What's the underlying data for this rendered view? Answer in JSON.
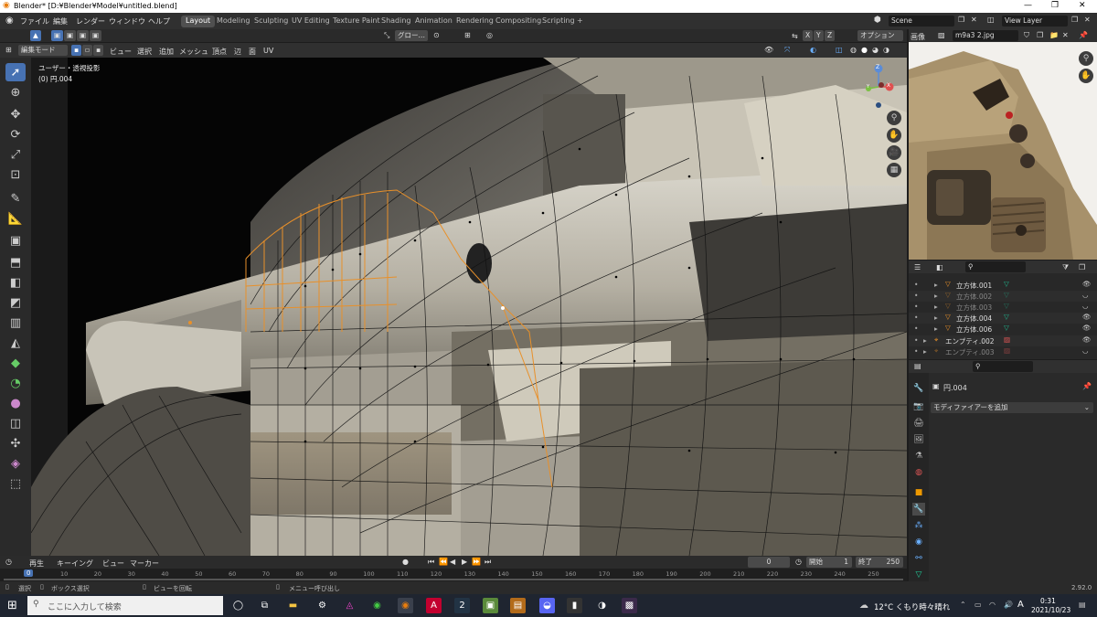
{
  "window": {
    "title": "Blender* [D:¥Blender¥Model¥untitled.blend]",
    "minimize": "—",
    "maximize": "❐",
    "close": "✕"
  },
  "menus": [
    "ファイル",
    "編集",
    "レンダー",
    "ウィンドウ",
    "ヘルプ"
  ],
  "workspaces": [
    "Layout",
    "Modeling",
    "Sculpting",
    "UV Editing",
    "Texture Paint",
    "Shading",
    "Animation",
    "Rendering",
    "Compositing",
    "Scripting"
  ],
  "active_workspace": "Layout",
  "scene": {
    "name": "Scene",
    "view_layer": "View Layer"
  },
  "header2": {
    "transform": "グロー…",
    "options": "オプション"
  },
  "axes": [
    "X",
    "Y",
    "Z"
  ],
  "viewport_header": {
    "mode": "編集モード",
    "menus": [
      "ビュー",
      "選択",
      "追加",
      "メッシュ",
      "頂点",
      "辺",
      "面",
      "UV"
    ]
  },
  "viewport_overlay": {
    "line1": "ユーザー・透視投影",
    "line2": "(0) 円.004"
  },
  "gizmo": {
    "x": "X",
    "y": "Y",
    "z": "Z"
  },
  "image_editor": {
    "label": "画像",
    "image_name": "m9a3 2.jpg"
  },
  "outliner": {
    "rows": [
      {
        "name": "立方体.001",
        "type": "mesh",
        "dim": false
      },
      {
        "name": "立方体.002",
        "type": "mesh",
        "dim": true
      },
      {
        "name": "立方体.003",
        "type": "mesh",
        "dim": true
      },
      {
        "name": "立方体.004",
        "type": "mesh",
        "dim": false
      },
      {
        "name": "立方体.006",
        "type": "mesh",
        "dim": false
      },
      {
        "name": "エンプティ.002",
        "type": "empty",
        "dim": false
      },
      {
        "name": "エンプティ.003",
        "type": "empty",
        "dim": true
      }
    ]
  },
  "properties": {
    "object": "円.004",
    "add_modifier": "モディファイアーを追加"
  },
  "timeline": {
    "menus": [
      "再生",
      "キーイング",
      "ビュー",
      "マーカー"
    ],
    "current_frame": "0",
    "start_label": "開始",
    "start": "1",
    "end_label": "終了",
    "end": "250"
  },
  "ruler": {
    "current": "0",
    "ticks": [
      "10",
      "20",
      "30",
      "40",
      "50",
      "60",
      "70",
      "80",
      "90",
      "100",
      "110",
      "120",
      "130",
      "140",
      "150",
      "160",
      "170",
      "180",
      "190",
      "200",
      "210",
      "220",
      "230",
      "240",
      "250"
    ]
  },
  "status": {
    "select": "選択",
    "box_select": "ボックス選択",
    "rotate": "ビューを回転",
    "menu": "メニュー呼び出し",
    "version": "2.92.0"
  },
  "taskbar": {
    "search_placeholder": "ここに入力して検索",
    "weather": "12°C くもり時々晴れ",
    "time": "0:31",
    "date": "2021/10/23",
    "ime": "A"
  },
  "colors": {
    "active_blue": "#4772b3",
    "orange": "#e8902a",
    "mesh_green": "#1fb48c"
  }
}
